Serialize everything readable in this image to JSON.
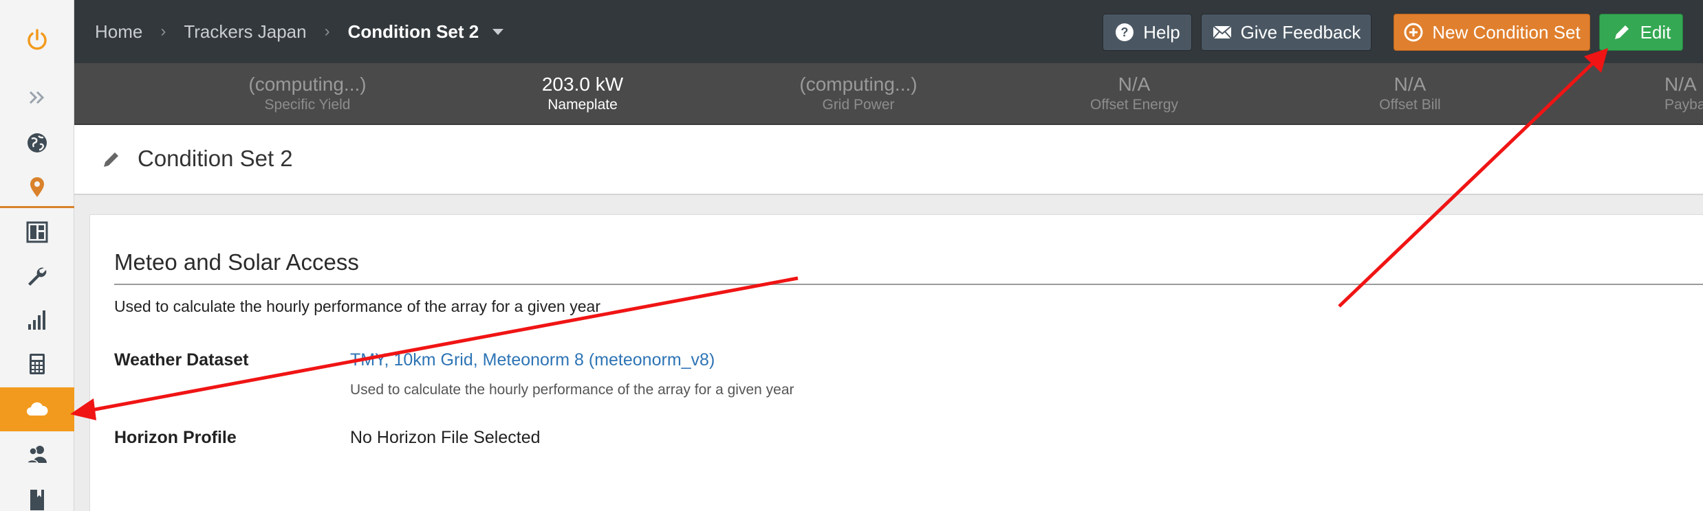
{
  "breadcrumb": {
    "items": [
      "Home",
      "Trackers Japan"
    ],
    "current": "Condition Set 2"
  },
  "header_buttons": {
    "help": "Help",
    "feedback": "Give Feedback",
    "new_condition_set": "New Condition Set",
    "edit": "Edit"
  },
  "metrics": [
    {
      "value": "(computing...)",
      "label": "Specific Yield"
    },
    {
      "value": "203.0 kW",
      "label": "Nameplate"
    },
    {
      "value": "(computing...)",
      "label": "Grid Power"
    },
    {
      "value": "N/A",
      "label": "Offset Energy"
    },
    {
      "value": "N/A",
      "label": "Offset Bill"
    },
    {
      "value": "N/A",
      "label": "Payback P"
    }
  ],
  "page_title": "Condition Set 2",
  "section": {
    "title": "Meteo and Solar Access",
    "description": "Used to calculate the hourly performance of the array for a given year",
    "weather_label": "Weather Dataset",
    "weather_value": "TMY, 10km Grid, Meteonorm 8 (meteonorm_v8)",
    "weather_help": "Used to calculate the hourly performance of the array for a given year",
    "horizon_label": "Horizon Profile",
    "horizon_value": "No Horizon File Selected"
  },
  "sidebar": {
    "items": [
      "power-icon",
      "expand-icon",
      "globe-icon",
      "location-pin-icon",
      "layout-icon",
      "wrench-icon",
      "bar-chart-icon",
      "calculator-icon",
      "cloud-icon",
      "users-icon",
      "book-icon"
    ],
    "active": "cloud-icon"
  },
  "colors": {
    "accent_orange": "#f29a1d",
    "edit_green": "#34a853",
    "new_orange": "#e07f2d",
    "link_blue": "#2e74b5",
    "annotation_red": "#f01414"
  }
}
